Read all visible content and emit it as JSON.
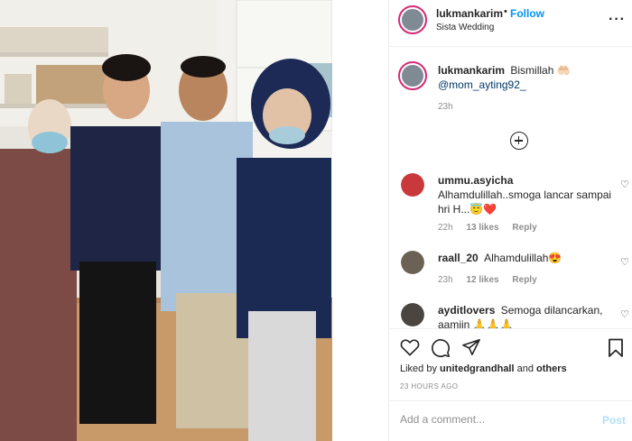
{
  "post": {
    "username": "lukmankarim",
    "separator": "•",
    "follow_label": "Follow",
    "location": "Sista Wedding",
    "more_icon": "more-horizontal-icon"
  },
  "caption": {
    "username": "lukmankarim",
    "text": "Bismillah 🤲🏻",
    "mention": "@mom_ayting92_",
    "time": "23h"
  },
  "load_more_icon": "plus-circle-icon",
  "comments": [
    {
      "username": "ummu.asyicha",
      "text_line1": "Alhamdulillah..smoga lancar sampai",
      "text_line2": "hri H...😇❤️",
      "time": "22h",
      "likes": "13 likes",
      "reply": "Reply",
      "avatar_color": "#c9383a"
    },
    {
      "username": "raall_20",
      "text_line1": "Alhamdulillah😍",
      "time": "23h",
      "likes": "12 likes",
      "reply": "Reply",
      "avatar_color": "#6b6255"
    },
    {
      "username": "aydi tlovers",
      "username_display": "ayditlovers",
      "text_line1": "Semoga dilancarkan,",
      "text_line2": "aamiin 🙏🙏🙏",
      "avatar_color": "#4a4540"
    }
  ],
  "actions": {
    "liked_by_prefix": "Liked by",
    "liked_by_user": "unitedgrandhall",
    "liked_by_and": "and",
    "liked_by_others": "others",
    "time_ago": "23 HOURS AGO"
  },
  "add_comment": {
    "placeholder": "Add a comment...",
    "post_label": "Post"
  },
  "colors": {
    "accent": "#0095f6",
    "post_disabled": "#b2dffc",
    "story_ring": "#d62976",
    "text": "#262626",
    "muted": "#8e8e8e"
  }
}
